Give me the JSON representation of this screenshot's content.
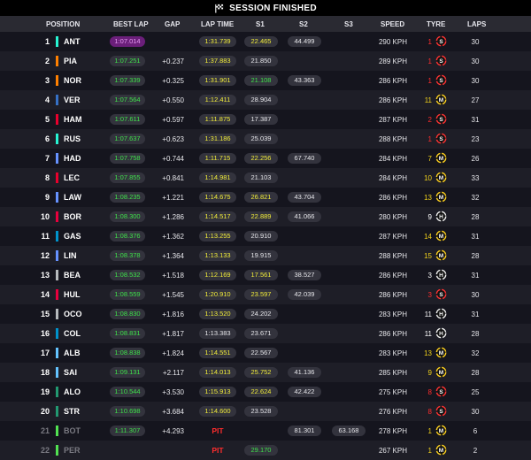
{
  "banner": {
    "title": "SESSION FINISHED"
  },
  "columns": {
    "position": "POSITION",
    "best_lap": "BEST LAP",
    "gap": "GAP",
    "lap_time": "LAP TIME",
    "s1": "S1",
    "s2": "S2",
    "s3": "S3",
    "speed": "SPEED",
    "tyre": "TYRE",
    "laps": "LAPS"
  },
  "colors": {
    "background": "#15151e",
    "row_alt": "#1e1e27",
    "personal_best": "#3fe34b",
    "overall_best": "#e59cf2",
    "yellow": "#f2ed3a",
    "pit": "#ff2d2d"
  },
  "drivers": [
    {
      "pos": "1",
      "code": "ANT",
      "team_color": "#27f4d2",
      "best": "1:07.014",
      "best_style": "purple",
      "gap": "",
      "lap": "1:31.739",
      "lap_style": "yellow",
      "s1": "22.465",
      "s1_style": "yellow",
      "s2": "44.499",
      "s2_style": "plain",
      "s3": "",
      "speed": "290 KPH",
      "tyre_age": "1",
      "tyre_age_color": "red",
      "tyre": "S",
      "tyre_icon": "soft-tyre-icon",
      "laps": "30",
      "out": false
    },
    {
      "pos": "2",
      "code": "PIA",
      "team_color": "#ff8000",
      "best": "1:07.251",
      "best_style": "green",
      "gap": "+0.237",
      "lap": "1:37.883",
      "lap_style": "yellow",
      "s1": "21.850",
      "s1_style": "plain",
      "s2": "",
      "s2_style": "plain",
      "s3": "",
      "speed": "289 KPH",
      "tyre_age": "1",
      "tyre_age_color": "red",
      "tyre": "S",
      "tyre_icon": "soft-tyre-icon",
      "laps": "30",
      "out": false
    },
    {
      "pos": "3",
      "code": "NOR",
      "team_color": "#ff8000",
      "best": "1:07.339",
      "best_style": "green",
      "gap": "+0.325",
      "lap": "1:31.901",
      "lap_style": "yellow",
      "s1": "21.108",
      "s1_style": "green",
      "s2": "43.363",
      "s2_style": "plain",
      "s3": "",
      "speed": "286 KPH",
      "tyre_age": "1",
      "tyre_age_color": "red",
      "tyre": "S",
      "tyre_icon": "soft-tyre-icon",
      "laps": "30",
      "out": false
    },
    {
      "pos": "4",
      "code": "VER",
      "team_color": "#3671c6",
      "best": "1:07.564",
      "best_style": "green",
      "gap": "+0.550",
      "lap": "1:12.411",
      "lap_style": "yellow",
      "s1": "28.904",
      "s1_style": "plain",
      "s2": "",
      "s2_style": "plain",
      "s3": "",
      "speed": "286 KPH",
      "tyre_age": "11",
      "tyre_age_color": "yellow",
      "tyre": "M",
      "tyre_icon": "medium-tyre-icon",
      "laps": "27",
      "out": false
    },
    {
      "pos": "5",
      "code": "HAM",
      "team_color": "#e8002d",
      "best": "1:07.611",
      "best_style": "green",
      "gap": "+0.597",
      "lap": "1:11.875",
      "lap_style": "yellow",
      "s1": "17.387",
      "s1_style": "plain",
      "s2": "",
      "s2_style": "plain",
      "s3": "",
      "speed": "287 KPH",
      "tyre_age": "2",
      "tyre_age_color": "red",
      "tyre": "S",
      "tyre_icon": "soft-tyre-icon",
      "laps": "31",
      "out": false
    },
    {
      "pos": "6",
      "code": "RUS",
      "team_color": "#27f4d2",
      "best": "1:07.637",
      "best_style": "green",
      "gap": "+0.623",
      "lap": "1:31.186",
      "lap_style": "yellow",
      "s1": "25.039",
      "s1_style": "plain",
      "s2": "",
      "s2_style": "plain",
      "s3": "",
      "speed": "288 KPH",
      "tyre_age": "1",
      "tyre_age_color": "red",
      "tyre": "S",
      "tyre_icon": "soft-tyre-icon",
      "laps": "23",
      "out": false
    },
    {
      "pos": "7",
      "code": "HAD",
      "team_color": "#6692ff",
      "best": "1:07.758",
      "best_style": "green",
      "gap": "+0.744",
      "lap": "1:11.715",
      "lap_style": "yellow",
      "s1": "22.256",
      "s1_style": "yellow",
      "s2": "67.740",
      "s2_style": "plain",
      "s3": "",
      "speed": "284 KPH",
      "tyre_age": "7",
      "tyre_age_color": "yellow",
      "tyre": "M",
      "tyre_icon": "medium-tyre-icon",
      "laps": "26",
      "out": false
    },
    {
      "pos": "8",
      "code": "LEC",
      "team_color": "#e8002d",
      "best": "1:07.855",
      "best_style": "green",
      "gap": "+0.841",
      "lap": "1:14.981",
      "lap_style": "yellow",
      "s1": "21.103",
      "s1_style": "plain",
      "s2": "",
      "s2_style": "plain",
      "s3": "",
      "speed": "284 KPH",
      "tyre_age": "10",
      "tyre_age_color": "yellow",
      "tyre": "M",
      "tyre_icon": "medium-tyre-icon",
      "laps": "33",
      "out": false
    },
    {
      "pos": "9",
      "code": "LAW",
      "team_color": "#6692ff",
      "best": "1:08.235",
      "best_style": "green",
      "gap": "+1.221",
      "lap": "1:14.675",
      "lap_style": "yellow",
      "s1": "26.821",
      "s1_style": "yellow",
      "s2": "43.704",
      "s2_style": "plain",
      "s3": "",
      "speed": "286 KPH",
      "tyre_age": "13",
      "tyre_age_color": "yellow",
      "tyre": "M",
      "tyre_icon": "medium-tyre-icon",
      "laps": "32",
      "out": false
    },
    {
      "pos": "10",
      "code": "BOR",
      "team_color": "#e8003d",
      "best": "1:08.300",
      "best_style": "green",
      "gap": "+1.286",
      "lap": "1:14.517",
      "lap_style": "yellow",
      "s1": "22.889",
      "s1_style": "yellow",
      "s2": "41.066",
      "s2_style": "plain",
      "s3": "",
      "speed": "280 KPH",
      "tyre_age": "9",
      "tyre_age_color": "white",
      "tyre": "H",
      "tyre_icon": "hard-tyre-icon",
      "laps": "28",
      "out": false
    },
    {
      "pos": "11",
      "code": "GAS",
      "team_color": "#0093cc",
      "best": "1:08.376",
      "best_style": "green",
      "gap": "+1.362",
      "lap": "1:13.255",
      "lap_style": "yellow",
      "s1": "20.910",
      "s1_style": "plain",
      "s2": "",
      "s2_style": "plain",
      "s3": "",
      "speed": "287 KPH",
      "tyre_age": "14",
      "tyre_age_color": "yellow",
      "tyre": "M",
      "tyre_icon": "medium-tyre-icon",
      "laps": "31",
      "out": false
    },
    {
      "pos": "12",
      "code": "LIN",
      "team_color": "#6692ff",
      "best": "1:08.378",
      "best_style": "green",
      "gap": "+1.364",
      "lap": "1:13.133",
      "lap_style": "yellow",
      "s1": "19.915",
      "s1_style": "plain",
      "s2": "",
      "s2_style": "plain",
      "s3": "",
      "speed": "288 KPH",
      "tyre_age": "15",
      "tyre_age_color": "yellow",
      "tyre": "M",
      "tyre_icon": "medium-tyre-icon",
      "laps": "28",
      "out": false
    },
    {
      "pos": "13",
      "code": "BEA",
      "team_color": "#b6babd",
      "best": "1:08.532",
      "best_style": "green",
      "gap": "+1.518",
      "lap": "1:12.169",
      "lap_style": "yellow",
      "s1": "17.561",
      "s1_style": "yellow",
      "s2": "38.527",
      "s2_style": "plain",
      "s3": "",
      "speed": "286 KPH",
      "tyre_age": "3",
      "tyre_age_color": "white",
      "tyre": "H",
      "tyre_icon": "hard-tyre-icon",
      "laps": "31",
      "out": false
    },
    {
      "pos": "14",
      "code": "HUL",
      "team_color": "#e8003d",
      "best": "1:08.559",
      "best_style": "green",
      "gap": "+1.545",
      "lap": "1:20.910",
      "lap_style": "yellow",
      "s1": "23.597",
      "s1_style": "yellow",
      "s2": "42.039",
      "s2_style": "plain",
      "s3": "",
      "speed": "286 KPH",
      "tyre_age": "3",
      "tyre_age_color": "red",
      "tyre": "S",
      "tyre_icon": "soft-tyre-icon",
      "laps": "30",
      "out": false
    },
    {
      "pos": "15",
      "code": "OCO",
      "team_color": "#b6babd",
      "best": "1:08.830",
      "best_style": "green",
      "gap": "+1.816",
      "lap": "1:13.520",
      "lap_style": "yellow",
      "s1": "24.202",
      "s1_style": "plain",
      "s2": "",
      "s2_style": "plain",
      "s3": "",
      "speed": "283 KPH",
      "tyre_age": "11",
      "tyre_age_color": "white",
      "tyre": "H",
      "tyre_icon": "hard-tyre-icon",
      "laps": "31",
      "out": false
    },
    {
      "pos": "16",
      "code": "COL",
      "team_color": "#0093cc",
      "best": "1:08.831",
      "best_style": "green",
      "gap": "+1.817",
      "lap": "1:13.383",
      "lap_style": "plain",
      "s1": "23.671",
      "s1_style": "plain",
      "s2": "",
      "s2_style": "plain",
      "s3": "",
      "speed": "286 KPH",
      "tyre_age": "11",
      "tyre_age_color": "white",
      "tyre": "H",
      "tyre_icon": "hard-tyre-icon",
      "laps": "28",
      "out": false
    },
    {
      "pos": "17",
      "code": "ALB",
      "team_color": "#64c4ff",
      "best": "1:08.838",
      "best_style": "green",
      "gap": "+1.824",
      "lap": "1:14.551",
      "lap_style": "yellow",
      "s1": "22.567",
      "s1_style": "plain",
      "s2": "",
      "s2_style": "plain",
      "s3": "",
      "speed": "283 KPH",
      "tyre_age": "13",
      "tyre_age_color": "yellow",
      "tyre": "M",
      "tyre_icon": "medium-tyre-icon",
      "laps": "32",
      "out": false
    },
    {
      "pos": "18",
      "code": "SAI",
      "team_color": "#64c4ff",
      "best": "1:09.131",
      "best_style": "green",
      "gap": "+2.117",
      "lap": "1:14.013",
      "lap_style": "yellow",
      "s1": "25.752",
      "s1_style": "yellow",
      "s2": "41.136",
      "s2_style": "plain",
      "s3": "",
      "speed": "285 KPH",
      "tyre_age": "9",
      "tyre_age_color": "yellow",
      "tyre": "M",
      "tyre_icon": "medium-tyre-icon",
      "laps": "28",
      "out": false
    },
    {
      "pos": "19",
      "code": "ALO",
      "team_color": "#229971",
      "best": "1:10.544",
      "best_style": "green",
      "gap": "+3.530",
      "lap": "1:15.913",
      "lap_style": "yellow",
      "s1": "22.624",
      "s1_style": "yellow",
      "s2": "42.422",
      "s2_style": "plain",
      "s3": "",
      "speed": "275 KPH",
      "tyre_age": "8",
      "tyre_age_color": "red",
      "tyre": "S",
      "tyre_icon": "soft-tyre-icon",
      "laps": "25",
      "out": false
    },
    {
      "pos": "20",
      "code": "STR",
      "team_color": "#229971",
      "best": "1:10.698",
      "best_style": "green",
      "gap": "+3.684",
      "lap": "1:14.600",
      "lap_style": "yellow",
      "s1": "23.528",
      "s1_style": "plain",
      "s2": "",
      "s2_style": "plain",
      "s3": "",
      "speed": "276 KPH",
      "tyre_age": "8",
      "tyre_age_color": "red",
      "tyre": "S",
      "tyre_icon": "soft-tyre-icon",
      "laps": "30",
      "out": false
    },
    {
      "pos": "21",
      "code": "BOT",
      "team_color": "#52e252",
      "best": "1:11.307",
      "best_style": "green",
      "gap": "+4.293",
      "lap": "PIT",
      "lap_style": "pit",
      "s1": "",
      "s1_style": "plain",
      "s2": "81.301",
      "s2_style": "plain",
      "s3": "63.168",
      "speed": "278 KPH",
      "tyre_age": "1",
      "tyre_age_color": "yellow",
      "tyre": "M",
      "tyre_icon": "medium-tyre-icon",
      "laps": "6",
      "out": true
    },
    {
      "pos": "22",
      "code": "PER",
      "team_color": "#52e252",
      "best": "",
      "best_style": "green",
      "gap": "",
      "lap": "PIT",
      "lap_style": "pit",
      "s1": "29.170",
      "s1_style": "green",
      "s2": "",
      "s2_style": "plain",
      "s3": "",
      "speed": "267 KPH",
      "tyre_age": "1",
      "tyre_age_color": "yellow",
      "tyre": "M",
      "tyre_icon": "medium-tyre-icon",
      "laps": "2",
      "out": true
    }
  ]
}
